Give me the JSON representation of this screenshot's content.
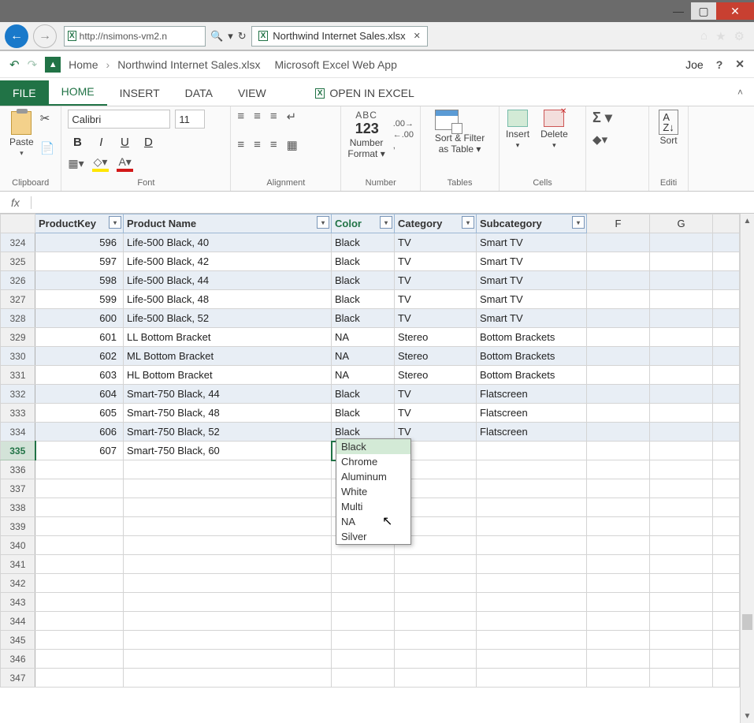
{
  "window": {
    "min": "—",
    "max": "▢",
    "close": "✕"
  },
  "browser": {
    "url": "http://nsimons-vm2.n",
    "tab_title": "Northwind Internet Sales.xlsx",
    "tab_close": "✕"
  },
  "docbar": {
    "crumb_home": "Home",
    "crumb_sep": "›",
    "crumb_doc": "Northwind Internet Sales.xlsx",
    "crumb_app": "Microsoft Excel Web App",
    "user": "Joe",
    "help": "?",
    "close": "✕"
  },
  "ribbon": {
    "tabs": {
      "file": "FILE",
      "home": "HOME",
      "insert": "INSERT",
      "data": "DATA",
      "view": "VIEW",
      "open": "OPEN IN EXCEL"
    },
    "collapse": "˄",
    "paste": "Paste",
    "clipboard": "Clipboard",
    "font_name": "Calibri",
    "font_size": "11",
    "font": "Font",
    "alignment": "Alignment",
    "number_label": "Number\nFormat ▾",
    "abc": "ABC",
    "num123": "123",
    "number_group": "Number",
    "sort_filter": "Sort & Filter\nas Table ▾",
    "tables": "Tables",
    "insert_btn": "Insert",
    "delete_btn": "Delete",
    "cells": "Cells",
    "sort": "Sort",
    "editing": "Editi"
  },
  "fx": {
    "label": "fx",
    "value": ""
  },
  "columns": {
    "ProductKey": "ProductKey",
    "ProductName": "Product Name",
    "Color": "Color",
    "Category": "Category",
    "Subcategory": "Subcategory",
    "F": "F",
    "G": "G"
  },
  "rows": [
    {
      "n": 324,
      "pk": 596,
      "name": "Life-500 Black, 40",
      "color": "Black",
      "cat": "TV",
      "sub": "Smart TV"
    },
    {
      "n": 325,
      "pk": 597,
      "name": "Life-500 Black, 42",
      "color": "Black",
      "cat": "TV",
      "sub": "Smart TV"
    },
    {
      "n": 326,
      "pk": 598,
      "name": "Life-500 Black, 44",
      "color": "Black",
      "cat": "TV",
      "sub": "Smart TV"
    },
    {
      "n": 327,
      "pk": 599,
      "name": "Life-500 Black, 48",
      "color": "Black",
      "cat": "TV",
      "sub": "Smart TV"
    },
    {
      "n": 328,
      "pk": 600,
      "name": "Life-500 Black, 52",
      "color": "Black",
      "cat": "TV",
      "sub": "Smart TV"
    },
    {
      "n": 329,
      "pk": 601,
      "name": "LL Bottom Bracket",
      "color": "NA",
      "cat": "Stereo",
      "sub": "Bottom Brackets"
    },
    {
      "n": 330,
      "pk": 602,
      "name": "ML Bottom Bracket",
      "color": "NA",
      "cat": "Stereo",
      "sub": "Bottom Brackets"
    },
    {
      "n": 331,
      "pk": 603,
      "name": "HL Bottom Bracket",
      "color": "NA",
      "cat": "Stereo",
      "sub": "Bottom Brackets"
    },
    {
      "n": 332,
      "pk": 604,
      "name": "Smart-750 Black, 44",
      "color": "Black",
      "cat": "TV",
      "sub": "Flatscreen"
    },
    {
      "n": 333,
      "pk": 605,
      "name": "Smart-750 Black, 48",
      "color": "Black",
      "cat": "TV",
      "sub": "Flatscreen"
    },
    {
      "n": 334,
      "pk": 606,
      "name": "Smart-750 Black, 52",
      "color": "Black",
      "cat": "TV",
      "sub": "Flatscreen"
    }
  ],
  "active_row": {
    "n": 335,
    "pk": 607,
    "name": "Smart-750 Black, 60"
  },
  "empty_rows": [
    336,
    337,
    338,
    339,
    340,
    341,
    342,
    343,
    344,
    345,
    346,
    347
  ],
  "dropdown": [
    "Black",
    "Chrome",
    "Aluminum",
    "White",
    "Multi",
    "NA",
    "Silver"
  ]
}
